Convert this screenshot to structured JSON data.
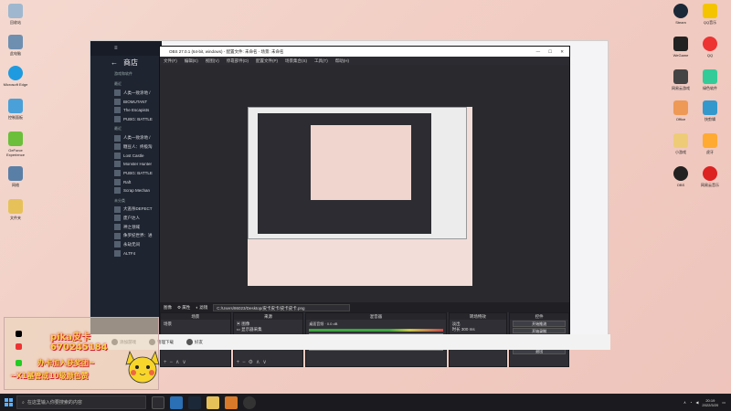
{
  "desktop": {
    "left_icons": [
      {
        "label": "回收站",
        "color": "#9fb8cf"
      },
      {
        "label": "此电脑",
        "color": "#6f8fb0"
      },
      {
        "label": "Microsoft Edge",
        "color": "#1e9be0"
      },
      {
        "label": "控制面板",
        "color": "#4aa0d8"
      },
      {
        "label": "GeForce Experience",
        "color": "#6cbf3b"
      },
      {
        "label": "网络",
        "color": "#5a7fa6"
      },
      {
        "label": "文件夹",
        "color": "#e6c15a"
      }
    ],
    "right_icons": [
      {
        "label": "Steam",
        "color": "#1b2838"
      },
      {
        "label": "QQ音乐",
        "color": "#f4c400"
      },
      {
        "label": "WeGame",
        "color": "#222"
      },
      {
        "label": "QQ",
        "color": "#e33"
      },
      {
        "label": "网易云游戏",
        "color": "#444"
      },
      {
        "label": "绿色软件",
        "color": "#3c9"
      },
      {
        "label": "Office",
        "color": "#e95"
      },
      {
        "label": "快剪辑",
        "color": "#39c"
      },
      {
        "label": "小游戏",
        "color": "#ec7"
      },
      {
        "label": "虎牙",
        "color": "#fa3"
      },
      {
        "label": "OBS",
        "color": "#222"
      },
      {
        "label": "网易云音乐",
        "color": "#d22"
      }
    ]
  },
  "steam": {
    "store_label": "商店",
    "sections": [
      {
        "title": "最近",
        "games": [
          "人类一败涂地 /",
          "BIOMUTANT",
          "The Escapists",
          "PUBG: BATTLE"
        ]
      },
      {
        "title": "最近",
        "games": [
          "人类一败涂地 /",
          "糖豆人：终极淘",
          "Lost Castle",
          "Monster Hunter",
          "PUBG: BATTLE",
          "Raft",
          "Scrap Mechan"
        ]
      },
      {
        "title": "未分类",
        "games": [
          "大逃杀DEFECT",
          "废户达人",
          "神之领域",
          "侏罗纪世界：进",
          "永劫无间",
          "ALTF4"
        ]
      }
    ],
    "library_label": "游戏和软件"
  },
  "obs": {
    "window_title": "OBS 27.0.1 (64-bit, windows) - 配置文件: 未命名 - 场景: 未命名",
    "menu": [
      "文件(F)",
      "编辑(E)",
      "视图(V)",
      "停靠部件(D)",
      "配置文件(P)",
      "场景集合(S)",
      "工具(T)",
      "帮助(H)"
    ],
    "props_bar": {
      "scene_label": "图像",
      "props_label": "属性",
      "filters_label": "滤镜",
      "path": "C:/Users/86023/Desktop/皮卡皮卡/皮卡皮卡.png"
    },
    "docks": {
      "scenes": {
        "title": "场景",
        "items": [
          "场景"
        ]
      },
      "sources": {
        "title": "来源",
        "items": [
          "图像",
          "显示器采集"
        ]
      },
      "mixer": {
        "title": "混音器",
        "rows": [
          {
            "name": "桌面音频",
            "level": "0.0 dB"
          },
          {
            "name": "麦克风/Aux",
            "level": "0.0 dB"
          }
        ]
      },
      "transitions": {
        "title": "转场特效",
        "type": "淡出",
        "duration_label": "时长",
        "duration": "300 ms"
      },
      "controls": {
        "title": "控件",
        "buttons": [
          "开始推流",
          "开始录制",
          "工作室模式",
          "设置",
          "退出"
        ]
      }
    },
    "status": {
      "live": "LIVE: 00:00:00",
      "rec": "REC: 00:00:00",
      "cpu": "CPU: 3.9%, 60.00 fps"
    }
  },
  "bottom_bar": {
    "buttons": [
      "添加游戏",
      "管理下载",
      "好友"
    ]
  },
  "overlay": {
    "name": "pika皮卡",
    "id": "670245184",
    "line1": "办卡加入获奖团~",
    "line2": "~X1基管或10级颜色赞"
  },
  "taskbar": {
    "search_placeholder": "在这里输入你要搜索的内容",
    "time": "20:19",
    "date": "2022/3/20"
  }
}
